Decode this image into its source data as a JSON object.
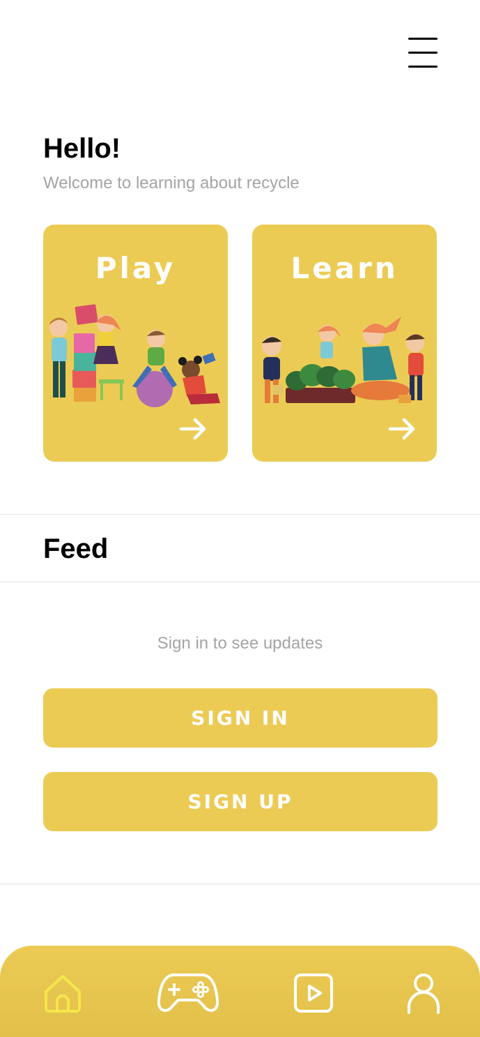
{
  "header": {
    "menu_icon": "hamburger-menu-icon"
  },
  "greeting": {
    "title": "Hello!",
    "subtitle": "Welcome to learning about recycle"
  },
  "cards": [
    {
      "title": "Play",
      "icon": "arrow-right-icon"
    },
    {
      "title": "Learn",
      "icon": "arrow-right-icon"
    }
  ],
  "feed": {
    "title": "Feed",
    "message": "Sign in to see updates",
    "sign_in_label": "SIGN IN",
    "sign_up_label": "SIGN UP"
  },
  "bottom_nav": {
    "items": [
      {
        "icon": "home-icon",
        "active": true
      },
      {
        "icon": "gamepad-icon",
        "active": false
      },
      {
        "icon": "video-icon",
        "active": false
      },
      {
        "icon": "profile-icon",
        "active": false
      }
    ]
  },
  "colors": {
    "accent": "#eccb55",
    "active_icon": "#f5e64a",
    "text_muted": "#a4a4a4",
    "text_dark": "#000000"
  }
}
